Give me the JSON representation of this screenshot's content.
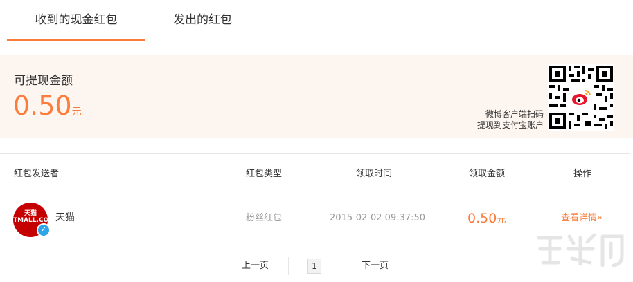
{
  "tabs": [
    {
      "label": "收到的现金红包",
      "active": true
    },
    {
      "label": "发出的红包",
      "active": false
    }
  ],
  "balance": {
    "label": "可提现金额",
    "amount": "0.50",
    "unit": "元",
    "qr_caption_line1": "微博客户端扫码",
    "qr_caption_line2": "提现到支付宝账户"
  },
  "table": {
    "headers": {
      "sender": "红包发送者",
      "type": "红包类型",
      "time": "领取时间",
      "amount": "领取金额",
      "op": "操作"
    },
    "rows": [
      {
        "avatar_text_line1": "天猫",
        "avatar_text_line2": "TMALL.COM",
        "sender": "天猫",
        "type": "粉丝红包",
        "time": "2015-02-02 09:37:50",
        "amount": "0.50",
        "unit": "元",
        "op": "查看详情»"
      }
    ]
  },
  "pager": {
    "prev": "上一页",
    "current": "1",
    "next": "下一页"
  },
  "colors": {
    "accent": "#fa7d3c",
    "balance_bg": "#fdf5ef",
    "tmall_red": "#c40000",
    "verified_blue": "#2fa4e7"
  }
}
